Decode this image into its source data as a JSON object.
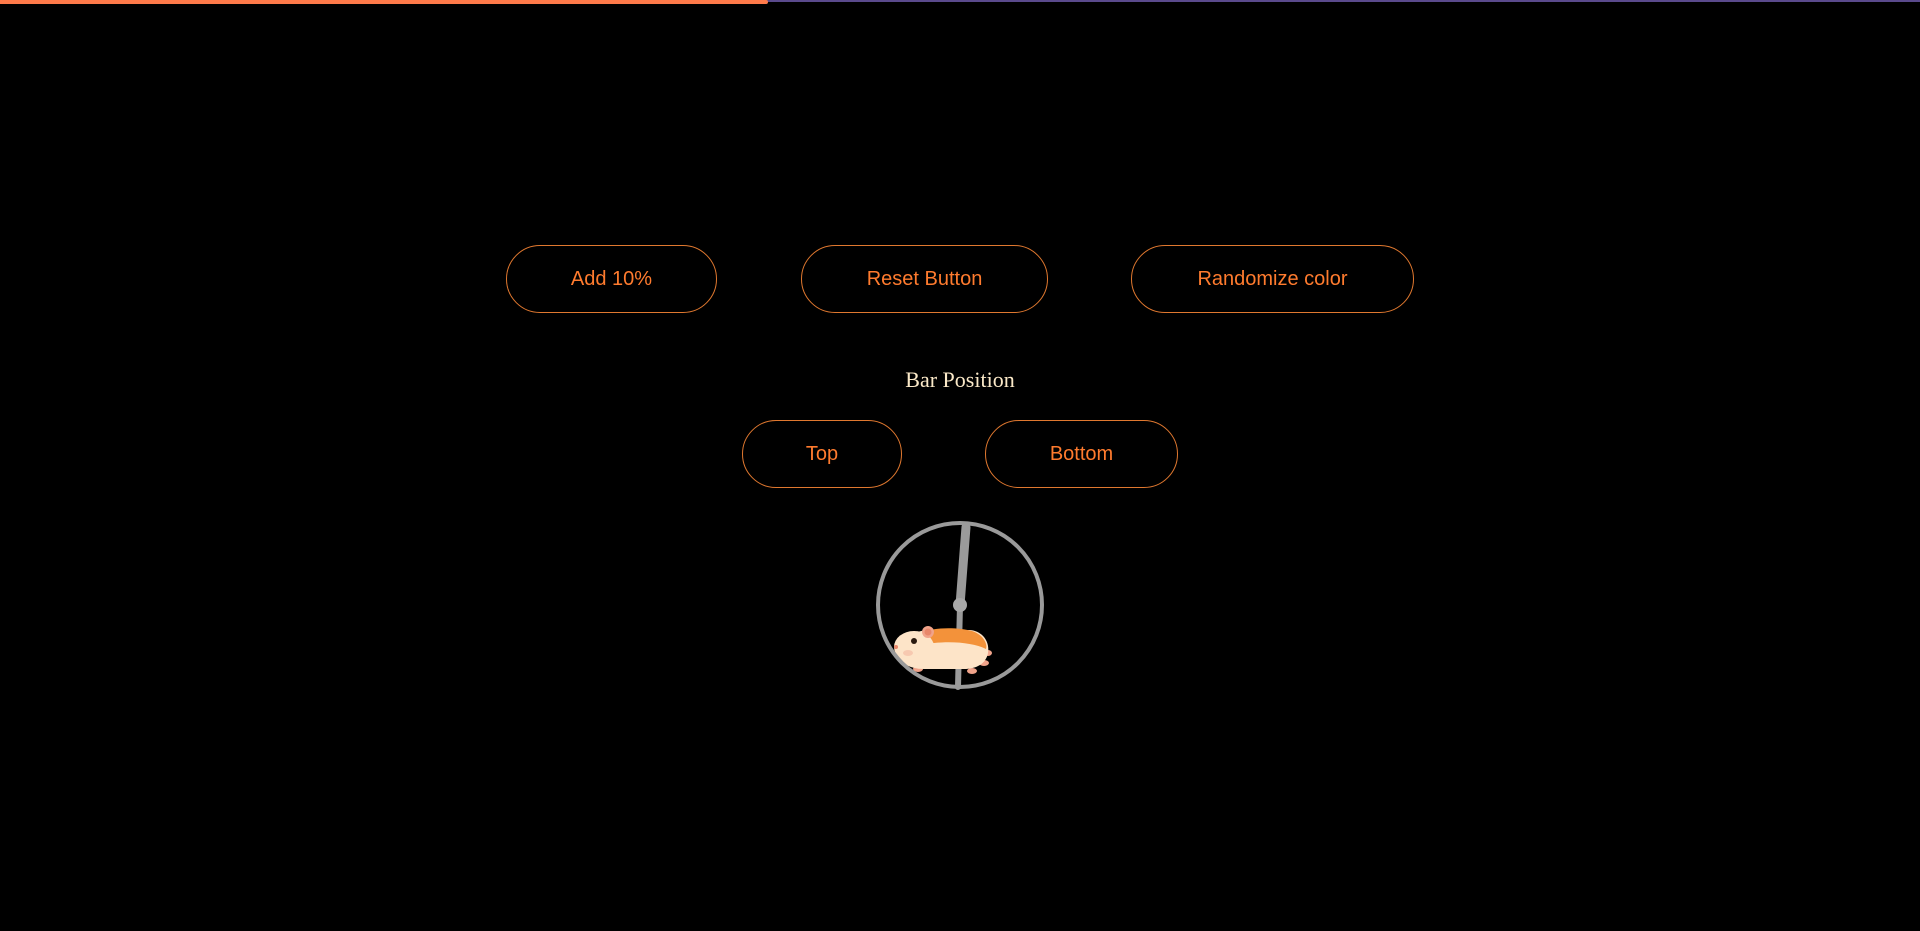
{
  "progress": {
    "value_percent": 40,
    "fill_color": "#ff7a4a",
    "track_color": "#5a4a8c"
  },
  "controls": {
    "add_label": "Add 10%",
    "reset_label": "Reset Button",
    "randomize_label": "Randomize color"
  },
  "position": {
    "heading": "Bar Position",
    "top_label": "Top",
    "bottom_label": "Bottom"
  },
  "loader": {
    "icon": "hamster-wheel-icon"
  },
  "colors": {
    "background": "#000000",
    "accent": "#ff7b2e",
    "heading_text": "#fbe9c8"
  }
}
